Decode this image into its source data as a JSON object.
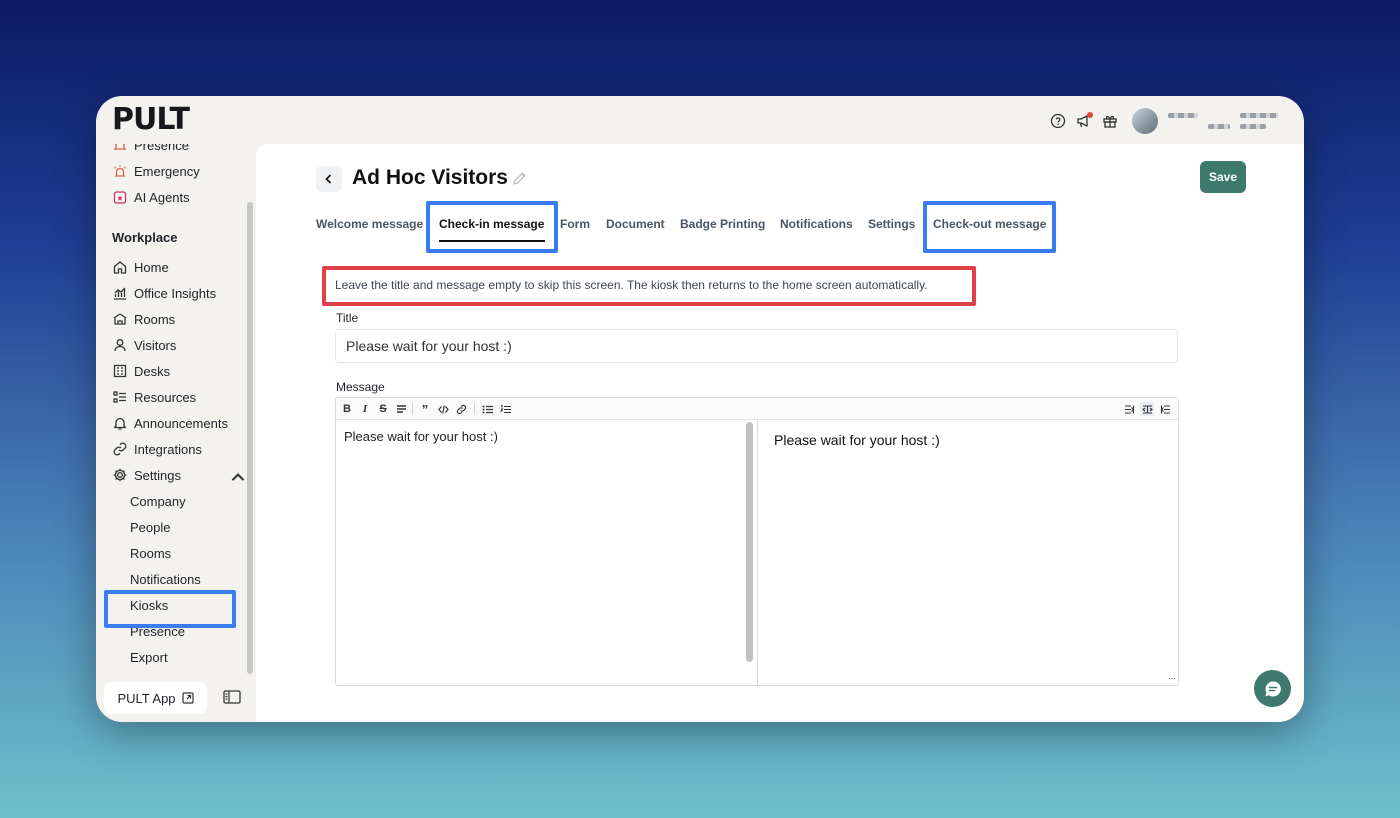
{
  "app": {
    "logo": "PULT"
  },
  "sidebar": {
    "top_items": [
      {
        "label": "Presence",
        "icon": "presence-icon"
      },
      {
        "label": "Emergency",
        "icon": "siren-icon"
      },
      {
        "label": "AI Agents",
        "icon": "ai-agent-icon"
      }
    ],
    "section_heading": "Workplace",
    "items": [
      {
        "label": "Home",
        "icon": "home-icon"
      },
      {
        "label": "Office Insights",
        "icon": "chart-icon"
      },
      {
        "label": "Rooms",
        "icon": "rooms-icon"
      },
      {
        "label": "Visitors",
        "icon": "person-icon"
      },
      {
        "label": "Desks",
        "icon": "desks-icon"
      },
      {
        "label": "Resources",
        "icon": "resources-icon"
      },
      {
        "label": "Announcements",
        "icon": "bell-icon"
      },
      {
        "label": "Integrations",
        "icon": "link-icon"
      },
      {
        "label": "Settings",
        "icon": "gear-icon"
      }
    ],
    "settings_sub": [
      "Company",
      "People",
      "Rooms",
      "Notifications",
      "Kiosks",
      "Presence",
      "Export"
    ],
    "footer_button": "PULT App"
  },
  "header": {
    "title": "Ad Hoc Visitors",
    "save_label": "Save"
  },
  "tabs": [
    {
      "label": "Welcome message",
      "active": false
    },
    {
      "label": "Check-in message",
      "active": true
    },
    {
      "label": "Form",
      "active": false
    },
    {
      "label": "Document",
      "active": false
    },
    {
      "label": "Badge Printing",
      "active": false
    },
    {
      "label": "Notifications",
      "active": false
    },
    {
      "label": "Settings",
      "active": false
    },
    {
      "label": "Check-out message",
      "active": false
    }
  ],
  "hint": "Leave the title and message empty to skip this screen. The kiosk then returns to the home screen automatically.",
  "form": {
    "title_label": "Title",
    "title_value": "Please wait for your host :)",
    "message_label": "Message",
    "message_value": "Please wait for your host :)",
    "preview_text": "Please wait for your host :)"
  },
  "colors": {
    "accent": "#3e7a6c",
    "highlight_blue": "#3a7cf2",
    "highlight_red": "#e04048",
    "notification_dot": "#e4463e"
  }
}
